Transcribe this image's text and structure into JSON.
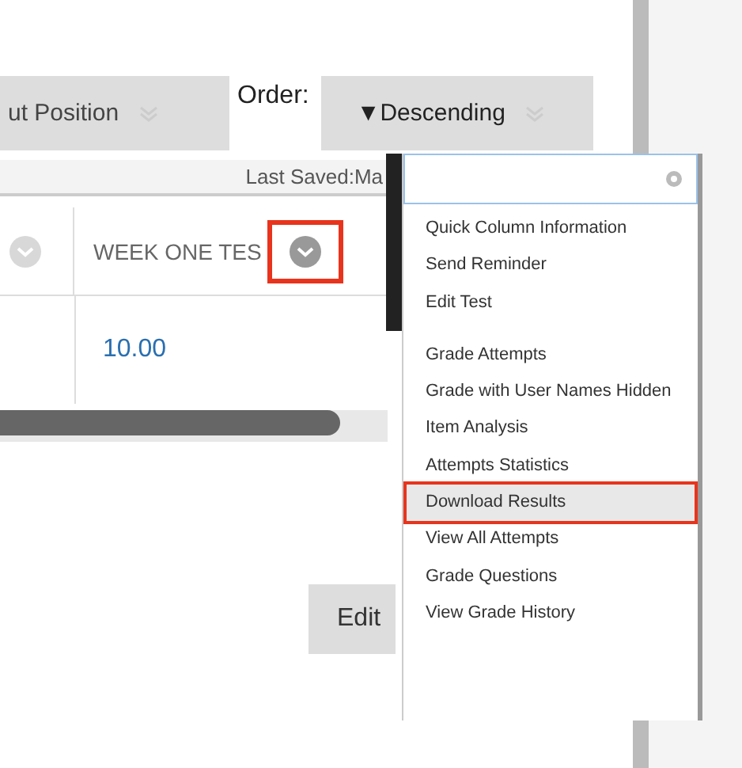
{
  "toolbar": {
    "sort_button": {
      "label": "ut Position"
    },
    "order_label": "Order:",
    "order_button": {
      "label": "▼Descending"
    }
  },
  "status": "Last Saved:Ma",
  "table": {
    "columns": [
      {
        "highlighted": false
      },
      {
        "label": "WEEK ONE TES",
        "highlighted": true
      }
    ],
    "rows": [
      {
        "grade": "10.00"
      }
    ]
  },
  "edit_button": "Edit",
  "menu": {
    "has_search": true,
    "groups": [
      {
        "items": [
          {
            "label": "Quick Column Information",
            "selected": false,
            "highlighted": false
          },
          {
            "label": "Send Reminder",
            "selected": false,
            "highlighted": false
          },
          {
            "label": "Edit Test",
            "selected": false,
            "highlighted": false
          }
        ]
      },
      {
        "items": [
          {
            "label": "Grade Attempts",
            "selected": false,
            "highlighted": false
          },
          {
            "label": "Grade with User Names Hidden",
            "selected": false,
            "highlighted": false
          },
          {
            "label": "Item Analysis",
            "selected": false,
            "highlighted": false
          },
          {
            "label": "Attempts Statistics",
            "selected": false,
            "highlighted": false
          },
          {
            "label": "Download Results",
            "selected": true,
            "highlighted": true
          },
          {
            "label": "View All Attempts",
            "selected": false,
            "highlighted": false
          },
          {
            "label": "Grade Questions",
            "selected": false,
            "highlighted": false
          },
          {
            "label": "View Grade History",
            "selected": false,
            "highlighted": false
          }
        ]
      }
    ]
  }
}
